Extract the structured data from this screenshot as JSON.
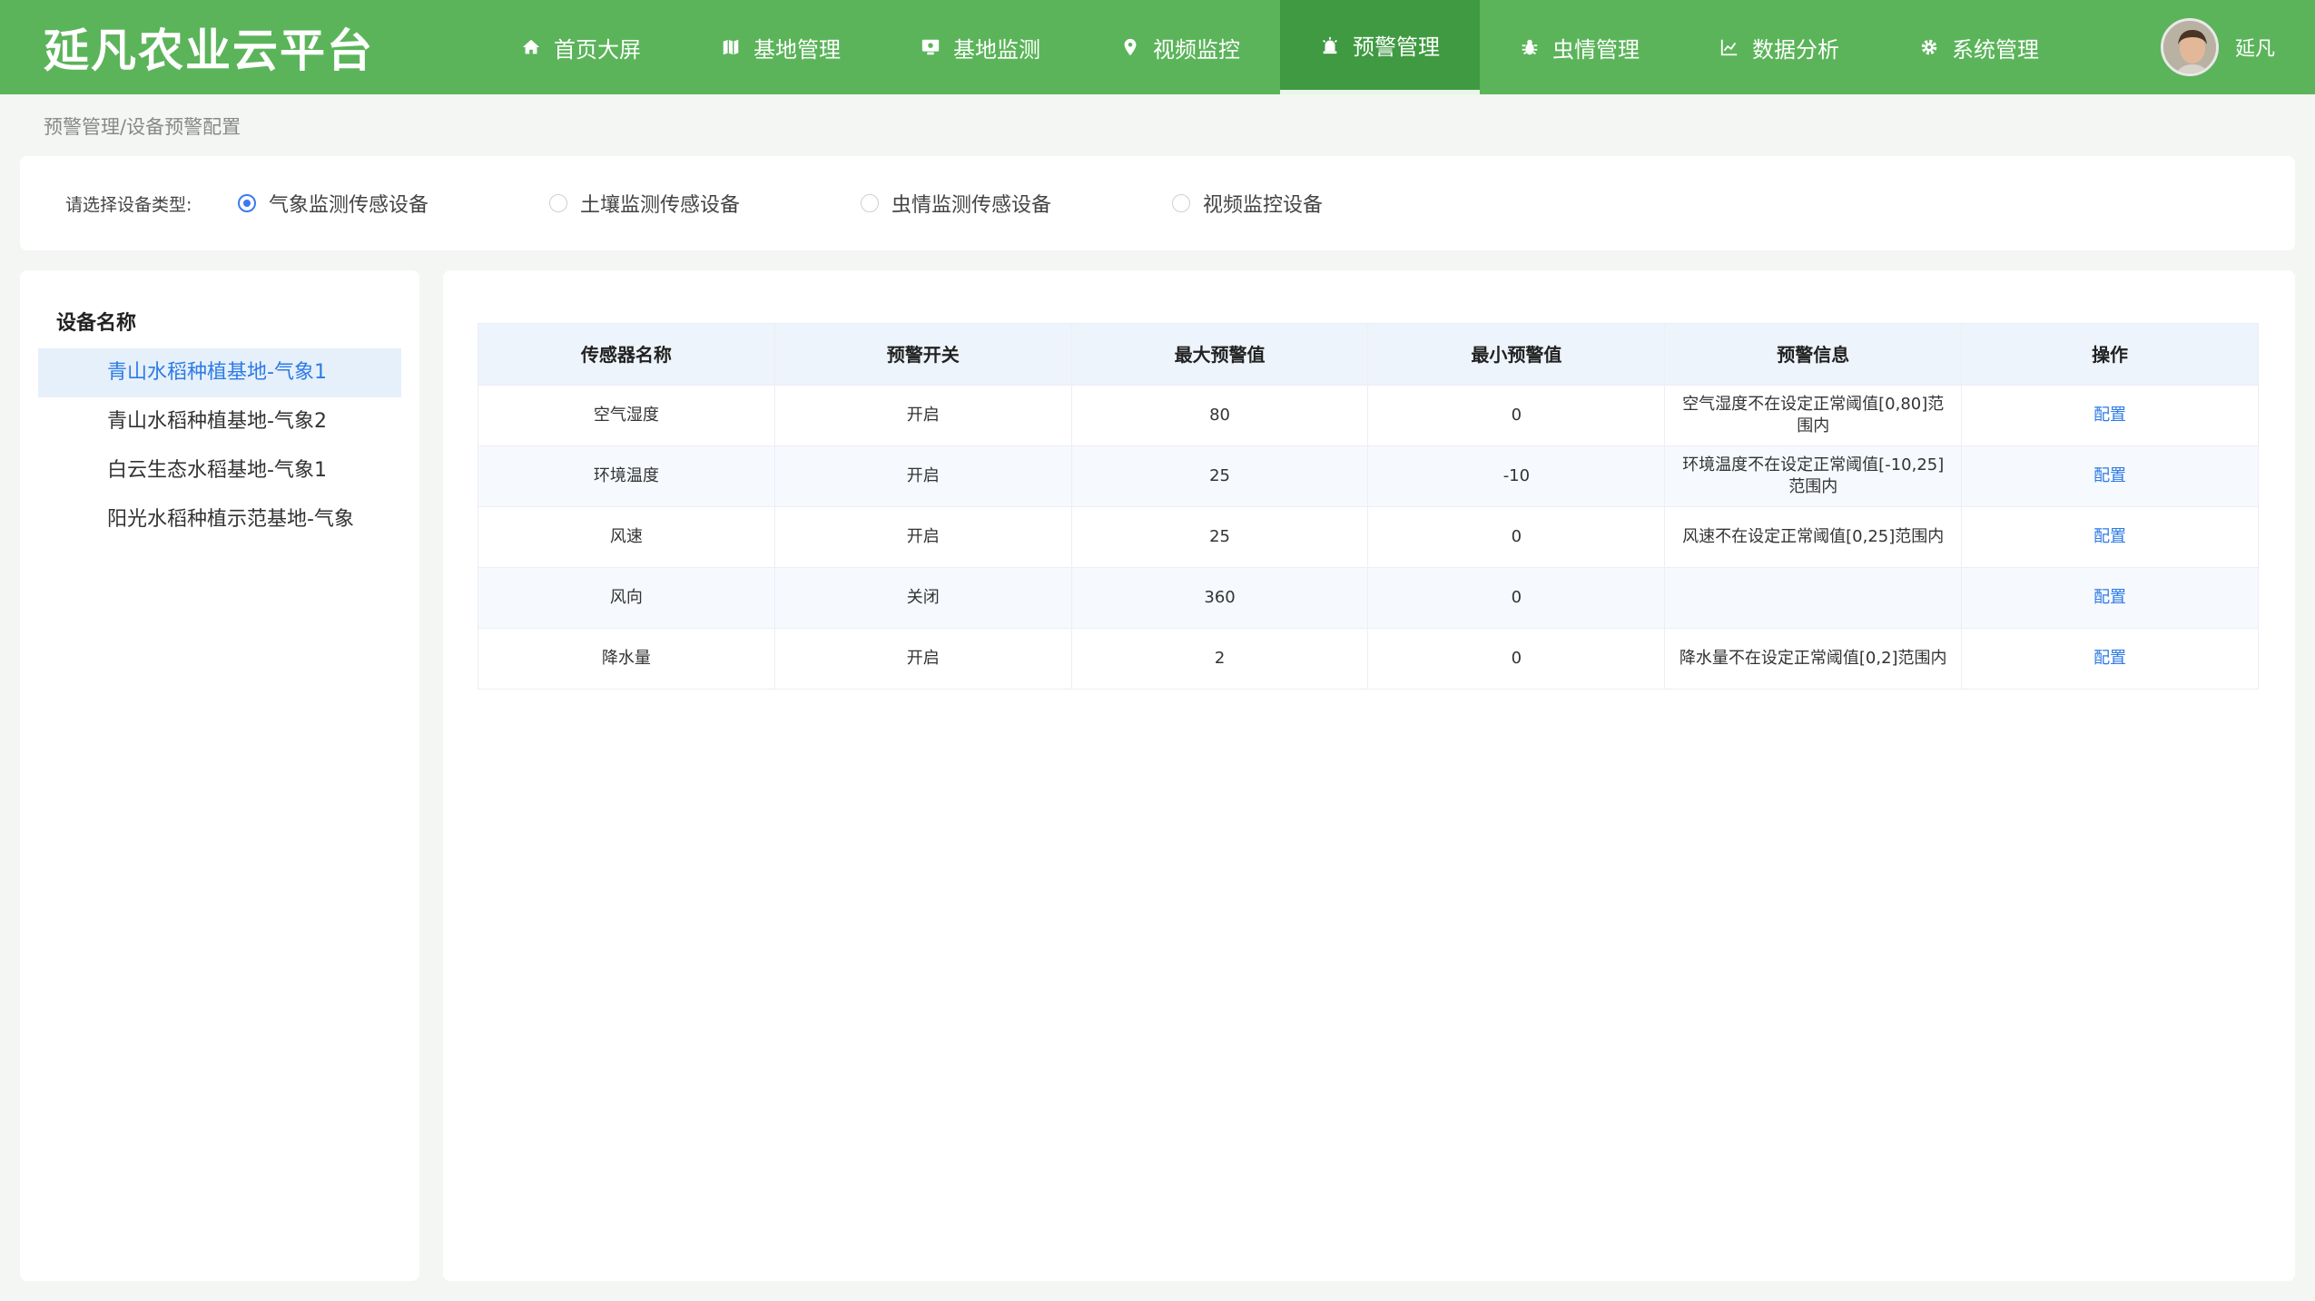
{
  "header": {
    "title": "延凡农业云平台",
    "nav": [
      {
        "label": "首页大屏",
        "icon": "home-icon"
      },
      {
        "label": "基地管理",
        "icon": "map-icon"
      },
      {
        "label": "基地监测",
        "icon": "monitor-icon"
      },
      {
        "label": "视频监控",
        "icon": "location-pin-icon"
      },
      {
        "label": "预警管理",
        "icon": "alarm-icon",
        "active": true
      },
      {
        "label": "虫情管理",
        "icon": "bug-icon"
      },
      {
        "label": "数据分析",
        "icon": "chart-icon"
      },
      {
        "label": "系统管理",
        "icon": "gear-icon"
      }
    ],
    "username": "延凡"
  },
  "breadcrumb": "预警管理/设备预警配置",
  "device_type": {
    "label": "请选择设备类型:",
    "options": [
      "气象监测传感设备",
      "土壤监测传感设备",
      "虫情监测传感设备",
      "视频监控设备"
    ],
    "selected": "气象监测传感设备"
  },
  "device_list": {
    "title": "设备名称",
    "items": [
      "青山水稻种植基地-气象1",
      "青山水稻种植基地-气象2",
      "白云生态水稻基地-气象1",
      "阳光水稻种植示范基地-气象"
    ],
    "selected": "青山水稻种植基地-气象1"
  },
  "table": {
    "headers": [
      "传感器名称",
      "预警开关",
      "最大预警值",
      "最小预警值",
      "预警信息",
      "操作"
    ],
    "rows": [
      {
        "name": "空气湿度",
        "switch": "开启",
        "max": "80",
        "min": "0",
        "info": "空气湿度不在设定正常阈值[0,80]范围内",
        "action": "配置"
      },
      {
        "name": "环境温度",
        "switch": "开启",
        "max": "25",
        "min": "-10",
        "info": "环境温度不在设定正常阈值[-10,25]范围内",
        "action": "配置"
      },
      {
        "name": "风速",
        "switch": "开启",
        "max": "25",
        "min": "0",
        "info": "风速不在设定正常阈值[0,25]范围内",
        "action": "配置"
      },
      {
        "name": "风向",
        "switch": "关闭",
        "max": "360",
        "min": "0",
        "info": "",
        "action": "配置"
      },
      {
        "name": "降水量",
        "switch": "开启",
        "max": "2",
        "min": "0",
        "info": "降水量不在设定正常阈值[0,2]范围内",
        "action": "配置"
      }
    ]
  },
  "colors": {
    "header_bg": "#5bb45a",
    "nav_active_bg": "#3f9a41",
    "link": "#2d7be5",
    "radio_selected": "#3a7bef"
  }
}
